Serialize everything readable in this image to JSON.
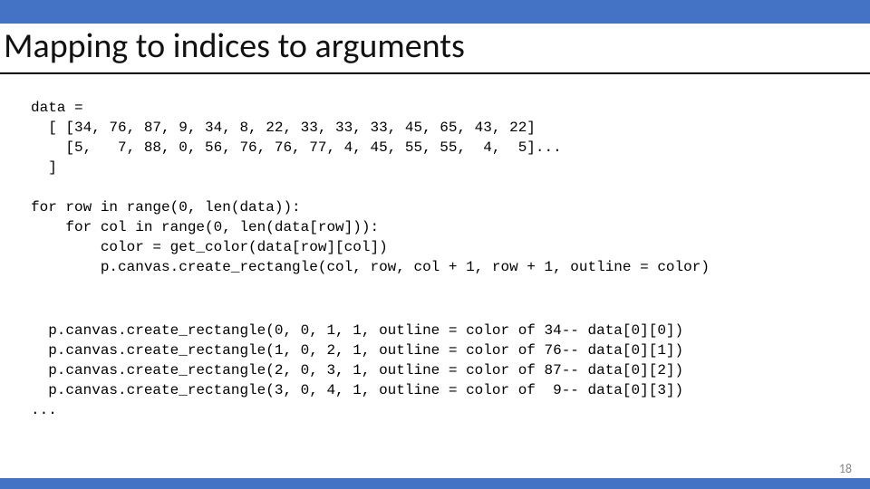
{
  "title": "Mapping to indices to arguments",
  "page_number": "18",
  "code": {
    "data_block": "data =\n  [ [34, 76, 87, 9, 34, 8, 22, 33, 33, 33, 45, 65, 43, 22]\n    [5,   7, 88, 0, 56, 76, 76, 77, 4, 45, 55, 55,  4,  5]...\n  ]",
    "loop_block": "for row in range(0, len(data)):\n    for col in range(0, len(data[row])):\n        color = get_color(data[row][col])\n        p.canvas.create_rectangle(col, row, col + 1, row + 1, outline = color)",
    "calls_block": "  p.canvas.create_rectangle(0, 0, 1, 1, outline = color of 34-- data[0][0])\n  p.canvas.create_rectangle(1, 0, 2, 1, outline = color of 76-- data[0][1])\n  p.canvas.create_rectangle(2, 0, 3, 1, outline = color of 87-- data[0][2])\n  p.canvas.create_rectangle(3, 0, 4, 1, outline = color of  9-- data[0][3])\n..."
  }
}
